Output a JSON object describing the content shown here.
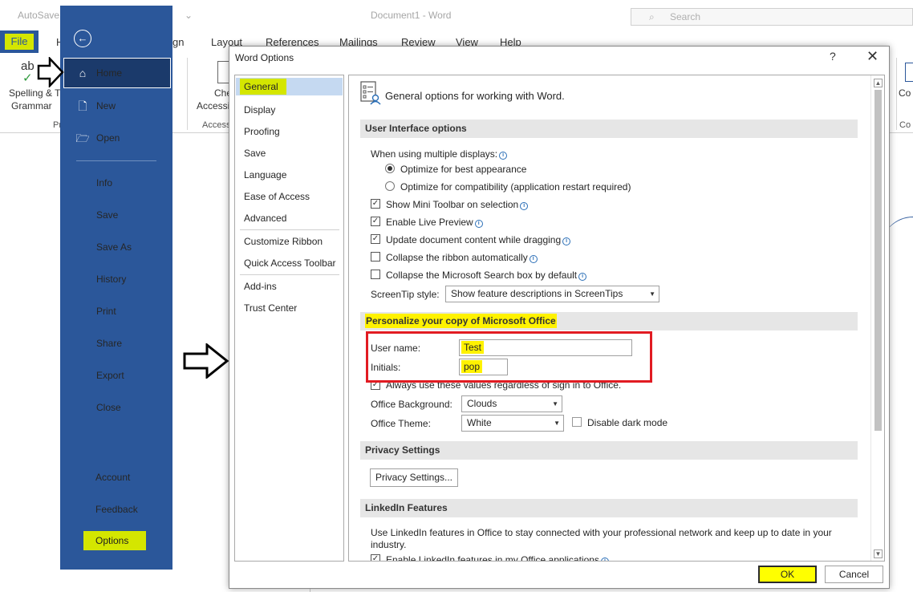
{
  "background_window": {
    "autosave_label": "AutoSave",
    "doc_title": "Document1 - Word",
    "search_placeholder": "Search",
    "ribbon_tabs": [
      "File",
      "Home",
      "Design",
      "Layout",
      "References",
      "Mailings",
      "Review",
      "View",
      "Help"
    ],
    "ribbon": {
      "spelling_label": "Spelling & Grammar",
      "spelling_line1": "Spelling & T",
      "spelling_line2": "Grammar",
      "proofing_group_partial": "Pr",
      "check_accessibility_line1": "Che",
      "check_accessibility_line2": "Accessi",
      "accessibility_group_partial": "Access",
      "comments_partial": "Co",
      "comments_group_partial": "Co"
    }
  },
  "backstage": {
    "items": [
      {
        "label": "Home",
        "icon": "home-icon",
        "selected": true
      },
      {
        "label": "New",
        "icon": "new-document-icon"
      },
      {
        "label": "Open",
        "icon": "folder-open-icon"
      },
      {
        "label": "Info"
      },
      {
        "label": "Save"
      },
      {
        "label": "Save As"
      },
      {
        "label": "History",
        "disabled": true
      },
      {
        "label": "Print"
      },
      {
        "label": "Share"
      },
      {
        "label": "Export"
      },
      {
        "label": "Close"
      },
      {
        "label": "Account"
      },
      {
        "label": "Feedback"
      },
      {
        "label": "Options",
        "highlighted": true
      }
    ]
  },
  "dialog": {
    "title": "Word Options",
    "help": "?",
    "close": "✕",
    "nav": [
      "General",
      "Display",
      "Proofing",
      "Save",
      "Language",
      "Ease of Access",
      "Advanced",
      "Customize Ribbon",
      "Quick Access Toolbar",
      "Add-ins",
      "Trust Center"
    ],
    "header_text": "General options for working with Word.",
    "ui_options": {
      "heading": "User Interface options",
      "multiple_displays_label": "When using multiple displays:",
      "radio_best_appearance": "Optimize for best appearance",
      "radio_compatibility": "Optimize for compatibility (application restart required)",
      "cb_mini_toolbar": "Show Mini Toolbar on selection",
      "cb_live_preview": "Enable Live Preview",
      "cb_update_dragging": "Update document content while dragging",
      "cb_collapse_ribbon": "Collapse the ribbon automatically",
      "cb_collapse_search": "Collapse the Microsoft Search box by default",
      "screentip_label": "ScreenTip style:",
      "screentip_value": "Show feature descriptions in ScreenTips"
    },
    "personalize": {
      "heading": "Personalize your copy of Microsoft Office",
      "user_name_label": "User name:",
      "user_name_value": "Test",
      "initials_label": "Initials:",
      "initials_value": "pop",
      "always_use_label": "Always use these values regardless of sign in to Office.",
      "background_label": "Office Background:",
      "background_value": "Clouds",
      "theme_label": "Office Theme:",
      "theme_value": "White",
      "dark_mode_label": "Disable dark mode"
    },
    "privacy": {
      "heading": "Privacy Settings",
      "button": "Privacy Settings..."
    },
    "linkedin": {
      "heading": "LinkedIn Features",
      "text_line1": "Use LinkedIn features in Office to stay connected with your professional network and keep up to date in your",
      "text_line2": "industry.",
      "cb_enable": "Enable LinkedIn features in my Office applications"
    },
    "ok": "OK",
    "cancel": "Cancel"
  },
  "colors": {
    "backstage_blue": "#2b579a",
    "highlight_yellow": "#d4e600",
    "red_box": "#e11b22",
    "nav_selected": "#c5d9f1"
  }
}
